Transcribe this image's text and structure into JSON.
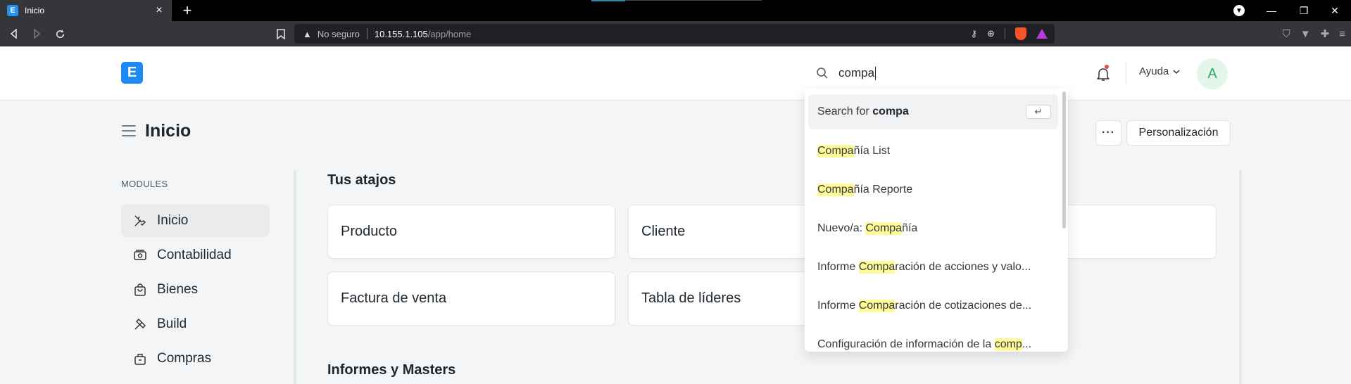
{
  "browser": {
    "tab_title": "Inicio",
    "new_tab": "+",
    "security_label": "No seguro",
    "url_host": "10.155.1.105",
    "url_path": "/app/home"
  },
  "navbar": {
    "logo_letter": "E",
    "help_label": "Ayuda",
    "avatar_initial": "A"
  },
  "page": {
    "title": "Inicio",
    "more_label": "···",
    "customize_label": "Personalización"
  },
  "sidebar": {
    "section_label": "MODULES",
    "items": [
      {
        "label": "Inicio",
        "icon": "tools-icon",
        "active": true
      },
      {
        "label": "Contabilidad",
        "icon": "accounting-icon",
        "active": false
      },
      {
        "label": "Bienes",
        "icon": "shopping-bag-icon",
        "active": false
      },
      {
        "label": "Build",
        "icon": "build-icon",
        "active": false
      },
      {
        "label": "Compras",
        "icon": "purchase-icon",
        "active": false
      }
    ]
  },
  "main": {
    "shortcuts_title": "Tus atajos",
    "shortcuts": [
      {
        "label": "Producto"
      },
      {
        "label": "Cliente"
      },
      {
        "label": "Factura de venta"
      },
      {
        "label": "Tabla de líderes"
      }
    ],
    "reports_title": "Informes y Masters"
  },
  "search": {
    "query": "compa",
    "search_for_prefix": "Search for ",
    "search_for_term": "compa",
    "enter_key": "↵",
    "results": [
      {
        "before": "",
        "match": "Compa",
        "after": "ñía List"
      },
      {
        "before": "",
        "match": "Compa",
        "after": "ñía Reporte"
      },
      {
        "before": "Nuevo/a: ",
        "match": "Compa",
        "after": "ñía"
      },
      {
        "before": "Informe ",
        "match": "Compa",
        "after": "ración de acciones y valo..."
      },
      {
        "before": "Informe ",
        "match": "Compa",
        "after": "ración de cotizaciones de..."
      },
      {
        "before": "Configuración de información de la ",
        "match": "comp",
        "after": "..."
      }
    ]
  },
  "colors": {
    "brand": "#1d89f5",
    "highlight": "#fffa99",
    "background": "#f4f5f6"
  }
}
